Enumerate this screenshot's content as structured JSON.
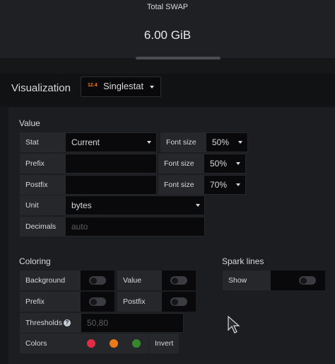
{
  "preview": {
    "title": "Total SWAP",
    "value": "6.00 GiB"
  },
  "visualization": {
    "label": "Visualization",
    "icon_text": "12.4",
    "selected": "Singlestat"
  },
  "value_section": {
    "title": "Value",
    "stat": {
      "label": "Stat",
      "value": "Current"
    },
    "prefix": {
      "label": "Prefix",
      "value": ""
    },
    "postfix": {
      "label": "Postfix",
      "value": ""
    },
    "unit": {
      "label": "Unit",
      "value": "bytes"
    },
    "decimals": {
      "label": "Decimals",
      "placeholder": "auto"
    },
    "font_size_stat": {
      "label": "Font size",
      "value": "50%"
    },
    "font_size_prefix": {
      "label": "Font size",
      "value": "50%"
    },
    "font_size_postfix": {
      "label": "Font size",
      "value": "70%"
    }
  },
  "coloring_section": {
    "title": "Coloring",
    "background": {
      "label": "Background",
      "on": false
    },
    "value": {
      "label": "Value",
      "on": false
    },
    "prefix": {
      "label": "Prefix",
      "on": false
    },
    "postfix": {
      "label": "Postfix",
      "on": false
    },
    "thresholds": {
      "label": "Thresholds",
      "placeholder": "50,80"
    },
    "colors": {
      "label": "Colors",
      "swatches": [
        "#e02f44",
        "#eb7b18",
        "#37872d"
      ],
      "invert_label": "Invert"
    }
  },
  "spark_section": {
    "title": "Spark lines",
    "show": {
      "label": "Show",
      "on": false
    }
  },
  "icons": {
    "help": "question-circle-icon",
    "cursor": "mouse-pointer-icon"
  }
}
